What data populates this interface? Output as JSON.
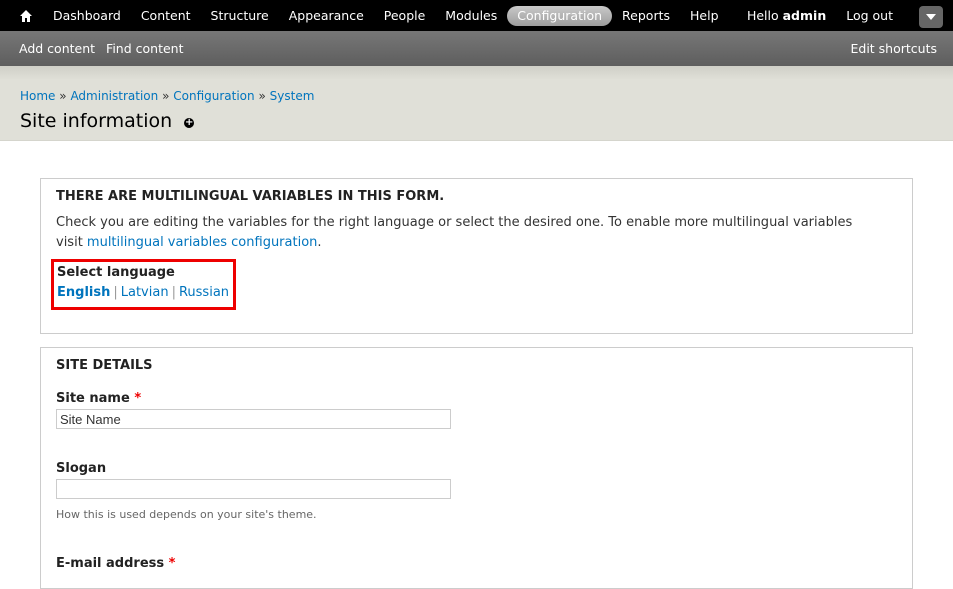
{
  "toolbar": {
    "menu": [
      "Dashboard",
      "Content",
      "Structure",
      "Appearance",
      "People",
      "Modules",
      "Configuration",
      "Reports",
      "Help"
    ],
    "active": "Configuration",
    "hello_prefix": "Hello",
    "username": "admin",
    "logout": "Log out"
  },
  "shortcuts": {
    "items": [
      "Add content",
      "Find content"
    ],
    "edit": "Edit shortcuts"
  },
  "breadcrumb": [
    "Home",
    "Administration",
    "Configuration",
    "System"
  ],
  "breadcrumb_sep": "»",
  "page_title": "Site information",
  "multilingual": {
    "legend": "There are multilingual variables in this form.",
    "desc_text": "Check you are editing the variables for the right language or select the desired one. To enable more multilingual variables visit ",
    "desc_link": "multilingual variables configuration",
    "desc_end": ".",
    "select_label": "Select language",
    "languages": [
      "English",
      "Latvian",
      "Russian"
    ],
    "current": "English"
  },
  "site_details": {
    "legend": "Site details",
    "site_name_label": "Site name",
    "site_name_value": "Site Name",
    "slogan_label": "Slogan",
    "slogan_value": "",
    "slogan_desc": "How this is used depends on your site's theme.",
    "email_label": "E-mail address",
    "required_mark": "*"
  }
}
